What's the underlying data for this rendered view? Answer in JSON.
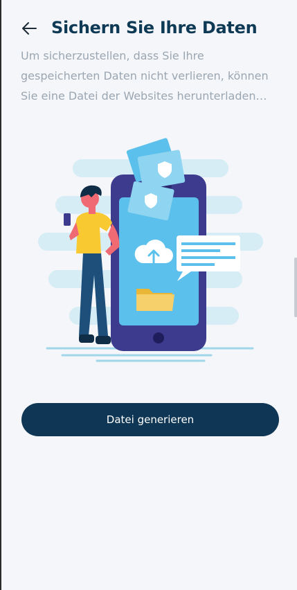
{
  "header": {
    "back_icon": "arrow-left-icon",
    "title": "Sichern Sie Ihre Daten"
  },
  "description": "Um sicherzustellen, dass Sie Ihre gespeicherten Daten nicht verlieren, können Sie eine Datei der Websites herunterladen un...",
  "illustration": {
    "subject": "person with smartphone backing up data to cloud",
    "icons": [
      "cloud-upload-icon",
      "folder-icon",
      "shield-document-icon",
      "chat-bubble-icon"
    ]
  },
  "primary_button": {
    "label": "Datei generieren"
  },
  "colors": {
    "background": "#f5f6f9",
    "title": "#0f3a56",
    "description": "#9aa6b2",
    "button": "#0f3654",
    "button_text": "#ffffff",
    "phone": "#3d3b8e",
    "phone_screen": "#5bc0eb"
  }
}
